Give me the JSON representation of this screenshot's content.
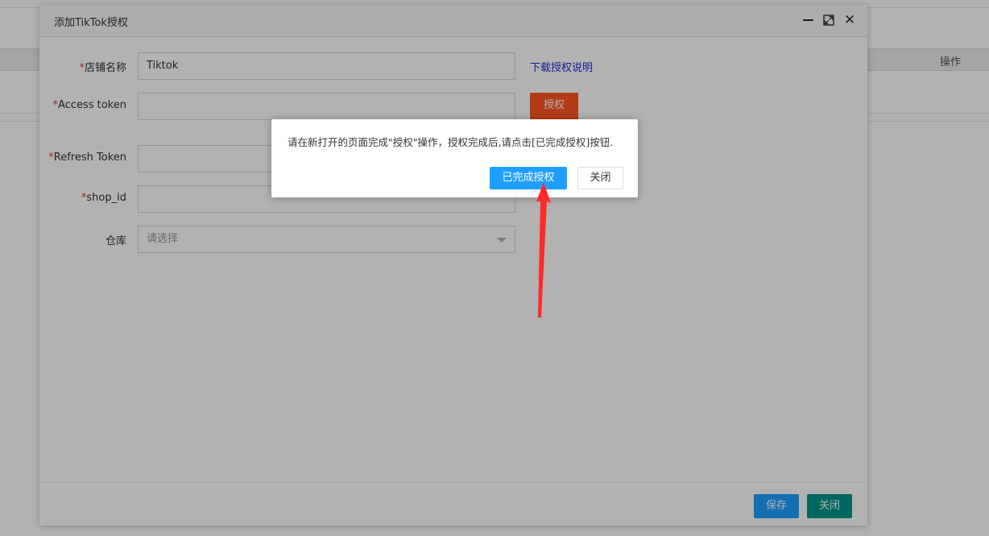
{
  "background": {
    "table_header_ops": "操作"
  },
  "dialog": {
    "title": "添加TikTok授权",
    "tools": {
      "minimize": "minimize-icon",
      "maximize": "maximize-icon",
      "close": "close-icon"
    },
    "form": {
      "required_mark": "*",
      "store_name_label": "店铺名称",
      "store_name_value": "Tiktok",
      "help_link": "下载授权说明",
      "access_token_label": "Access token",
      "access_token_value": "",
      "authorize_button": "授权",
      "refresh_token_label": "Refresh Token",
      "refresh_token_value": "",
      "shop_id_label": "shop_id",
      "shop_id_value": "",
      "warehouse_label": "仓库",
      "warehouse_placeholder": "请选择"
    },
    "footer": {
      "save_button": "保存",
      "close_button": "关闭"
    }
  },
  "confirm": {
    "message": "请在新打开的页面完成\"授权\"操作，授权完成后,请点击[已完成授权]按钮.",
    "done_button": "已完成授权",
    "close_button": "关闭"
  },
  "colors": {
    "primary_blue": "#1e9fff",
    "teal": "#009688",
    "authorize_orange": "#ff5722",
    "link_blue": "#1e2bd0",
    "required_red": "#ee3333",
    "annotation_red": "#ff2a2a"
  }
}
